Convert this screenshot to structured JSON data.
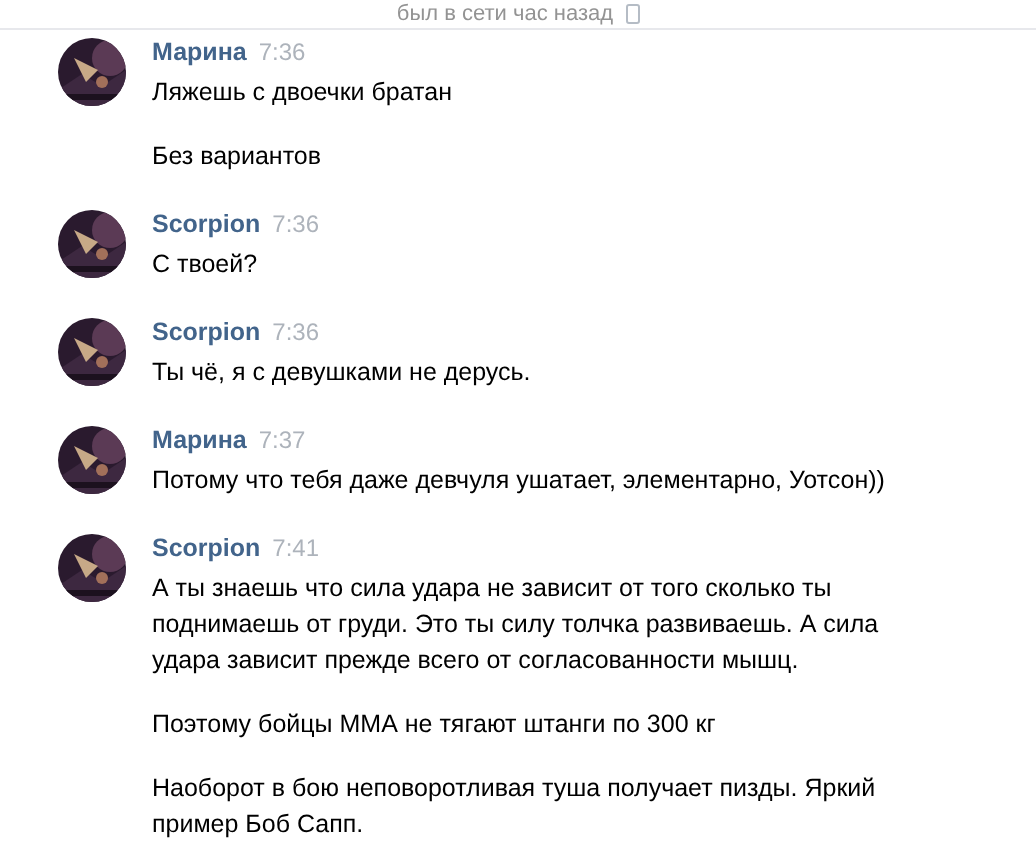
{
  "header": {
    "status": "был в сети час назад"
  },
  "messages": [
    {
      "author": "Марина",
      "time": "7:36",
      "paragraphs": [
        "Ляжешь с двоечки братан",
        "Без вариантов"
      ]
    },
    {
      "author": "Scorpion",
      "time": "7:36",
      "paragraphs": [
        "С твоей?"
      ]
    },
    {
      "author": "Scorpion",
      "time": "7:36",
      "paragraphs": [
        "Ты чё, я с девушками не дерусь."
      ]
    },
    {
      "author": "Марина",
      "time": "7:37",
      "paragraphs": [
        "Потому что тебя даже девчуля ушатает, элементарно, Уотсон))"
      ]
    },
    {
      "author": "Scorpion",
      "time": "7:41",
      "paragraphs": [
        "А ты знаешь что сила удара не зависит от того сколько ты поднимаешь от груди. Это ты силу толчка развиваешь. А сила удара зависит прежде всего от согласованности мышц.",
        "Поэтому бойцы ММА не тягают штанги по 300 кг",
        "Наоборот в бою неповоротливая туша получает пизды. Яркий пример Боб Сапп."
      ]
    }
  ]
}
